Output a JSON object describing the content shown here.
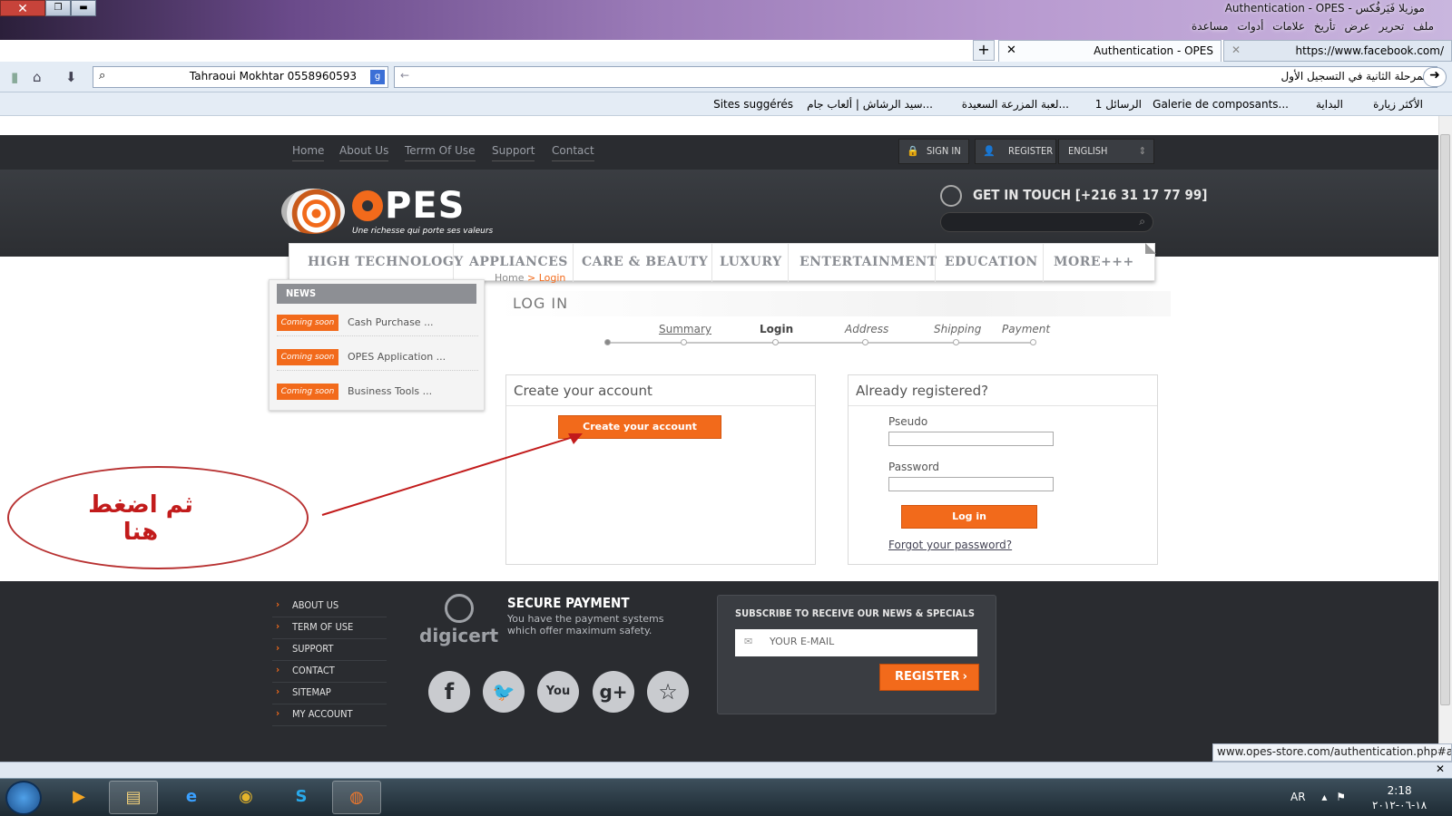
{
  "window": {
    "title": "Authentication - OPES - موزيلا فَيَرفُكس",
    "menu": [
      "ملف",
      "تحرير",
      "عرض",
      "تأريخ",
      "علامات",
      "أدوات",
      "مساعدة"
    ],
    "close_glyph": "✕",
    "max_glyph": "❐",
    "min_glyph": "▬"
  },
  "tabs": {
    "active": {
      "title": "Authentication - OPES",
      "close": "✕"
    },
    "other": {
      "title": "https://www.facebook.com/",
      "close": "✕"
    },
    "new_tab": "+"
  },
  "navbar": {
    "search_value": "Tahraoui Mokhtar 0558960593",
    "search_engine_glyph": "g",
    "url_text": "المرحلة الثانية في التسجيل الأول",
    "back_glyph": "←",
    "forward_glyph": "➜",
    "home_glyph": "⌂",
    "download_glyph": "⬇"
  },
  "bookmarks": [
    "الأكثر زيارة",
    "البداية",
    "Galerie de composants...",
    "1 الرسائل",
    "لعبة المزرعة السعيدة...",
    "سيد الرشاش | ألعاب جام...",
    "Sites suggérés"
  ],
  "site": {
    "top_links": [
      "Home",
      "About Us",
      "Terrm Of Use",
      "Support",
      "Contact"
    ],
    "sign_in": "SIGN IN",
    "register": "REGISTER",
    "language": "ENGLISH",
    "logo_text": "PES",
    "logo_tagline": "Une richesse qui porte ses valeurs",
    "phone": "GET IN TOUCH [+216 31 17 77 99]",
    "search_icon": "⌕",
    "categories": [
      "HIGH TECHNOLOGY",
      "APPLIANCES",
      "CARE & BEAUTY",
      "LUXURY",
      "ENTERTAINMENT",
      "EDUCATION",
      "MORE+++"
    ],
    "news": {
      "title": "NEWS",
      "items": [
        {
          "badge": "Coming soon",
          "text": "Cash Purchase ..."
        },
        {
          "badge": "Coming soon",
          "text": "OPES Application ..."
        },
        {
          "badge": "Coming soon",
          "text": "Business Tools ..."
        }
      ]
    },
    "breadcrumb": {
      "home": "Home",
      "sep": ">",
      "current": "Login"
    },
    "page_title": "LOG IN",
    "steps": [
      "Summary",
      "Login",
      "Address",
      "Shipping",
      "Payment"
    ],
    "create": {
      "title": "Create your account",
      "button": "Create your account"
    },
    "login": {
      "title": "Already registered?",
      "pseudo_label": "Pseudo",
      "password_label": "Password",
      "button": "Log in",
      "forgot": "Forgot your password?"
    },
    "annotation": "ثم اضغط هنا",
    "footer": {
      "links": [
        "ABOUT US",
        "TERM OF USE",
        "SUPPORT",
        "CONTACT",
        "SITEMAP",
        "MY ACCOUNT"
      ],
      "digicert": "digicert",
      "secure_title": "SECURE PAYMENT",
      "secure_text": "You have the payment systems which offer maximum safety.",
      "social": [
        {
          "name": "facebook-icon",
          "glyph": "f"
        },
        {
          "name": "twitter-icon",
          "glyph": "🐦"
        },
        {
          "name": "youtube-icon",
          "glyph": "You"
        },
        {
          "name": "google-plus-icon",
          "glyph": "g+"
        },
        {
          "name": "favorite-star-icon",
          "glyph": "☆"
        }
      ],
      "subscribe_title": "SUBSCRIBE TO RECEIVE OUR NEWS & SPECIALS",
      "email_placeholder": "YOUR E-MAIL",
      "register_button": "REGISTER"
    }
  },
  "status_url": "www.opes-store.com/authentication.php#ancre",
  "taskbar": {
    "lang": "AR",
    "time": "2:18",
    "date": "١٨-٠٦-٢٠١٢"
  },
  "colors": {
    "accent": "#f26a1b",
    "dark": "#2a2c30",
    "annotation": "#c21b1b"
  }
}
